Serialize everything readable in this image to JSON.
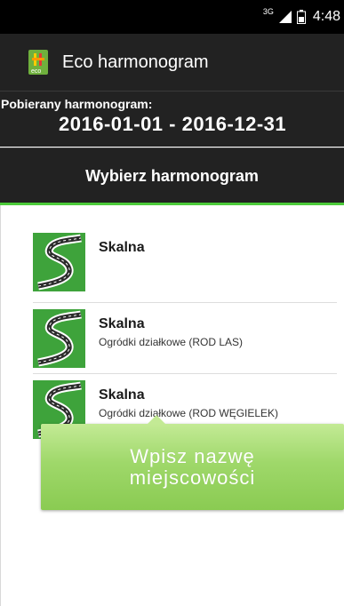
{
  "status_bar": {
    "network": "3G",
    "time": "4:48",
    "icons": [
      "signal-icon",
      "battery-icon"
    ]
  },
  "app_bar": {
    "title": "Eco harmonogram",
    "icon": "eco-app-icon",
    "icon_text": "eco"
  },
  "schedule": {
    "label": "Pobierany harmonogram:",
    "range": "2016-01-01 - 2016-12-31"
  },
  "section": {
    "title": "Wybierz harmonogram"
  },
  "list": {
    "items": [
      {
        "name": "Skalna",
        "subtitle": ""
      },
      {
        "name": "Skalna",
        "subtitle": "Ogródki działkowe (ROD LAS)"
      },
      {
        "name": "Skalna",
        "subtitle": "Ogródki działkowe (ROD WĘGIELEK)"
      }
    ],
    "item_icon": "road-icon"
  },
  "toast": {
    "line1": "Wpisz nazwę",
    "line2": "miejscowości"
  },
  "colors": {
    "accent": "#4ccb3a",
    "bar_background": "#222222",
    "thumb_green": "#3ea33b",
    "toast_green": "#9fd86a"
  }
}
